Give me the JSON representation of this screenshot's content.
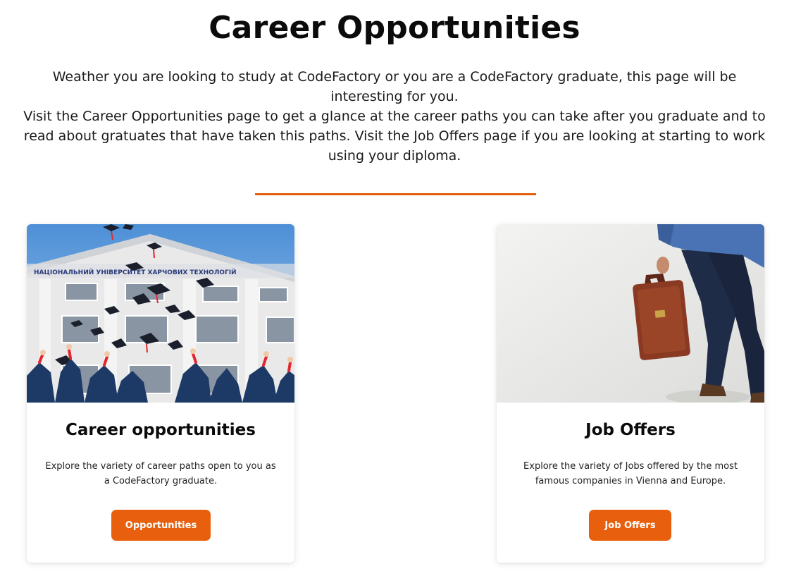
{
  "header": {
    "title": "Career Opportunities",
    "intro_line1": "Weather you are looking to study at CodeFactory or you are a CodeFactory graduate, this page will be interesting for you.",
    "intro_line2": "Visit the Career Opportunities page to get a glance at the career paths you can take after you graduate and to read about gratuates that have taken this paths. Visit the Job Offers page if you are looking at starting to work using your diploma."
  },
  "accent_color": "#e8600e",
  "cards": [
    {
      "title": "Career opportunities",
      "text": "Explore the variety of career paths open to you as a CodeFactory graduate.",
      "button": "Opportunities",
      "image_icon": "graduation-caps-photo"
    },
    {
      "title": "Job Offers",
      "text": "Explore the variety of Jobs offered by the most famous companies in Vienna and Europe.",
      "button": "Job Offers",
      "image_icon": "businessman-briefcase-photo"
    }
  ]
}
